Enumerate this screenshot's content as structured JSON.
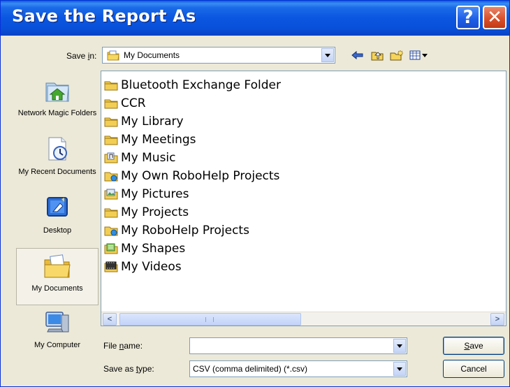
{
  "window": {
    "title": "Save the Report As",
    "help_glyph": "?",
    "close_glyph": "✕"
  },
  "save_in": {
    "label_pre": "Save ",
    "label_ul": "i",
    "label_post": "n:",
    "value": "My Documents",
    "icon": "my-documents-icon"
  },
  "toolbar": {
    "icons": [
      "back-arrow-icon",
      "up-folder-icon",
      "new-folder-icon",
      "view-menu-icon"
    ]
  },
  "places": [
    {
      "label": "Network Magic Folders",
      "icon": "network-magic-folders-icon",
      "active": false
    },
    {
      "label": "My Recent Documents",
      "icon": "recent-documents-icon",
      "active": false
    },
    {
      "label": "Desktop",
      "icon": "desktop-icon",
      "active": false
    },
    {
      "label": "My Documents",
      "icon": "my-documents-icon",
      "active": true
    },
    {
      "label": "My Computer",
      "icon": "my-computer-icon",
      "active": false
    }
  ],
  "files": [
    {
      "name": "Bluetooth Exchange Folder",
      "icon": "folder-icon"
    },
    {
      "name": "CCR",
      "icon": "folder-icon"
    },
    {
      "name": "My Library",
      "icon": "folder-icon"
    },
    {
      "name": "My Meetings",
      "icon": "folder-icon"
    },
    {
      "name": "My Music",
      "icon": "music-folder-icon"
    },
    {
      "name": "My Own RoboHelp Projects",
      "icon": "robohelp-folder-icon"
    },
    {
      "name": "My Pictures",
      "icon": "pictures-folder-icon"
    },
    {
      "name": "My Projects",
      "icon": "folder-icon"
    },
    {
      "name": "My RoboHelp Projects",
      "icon": "robohelp-folder-icon"
    },
    {
      "name": "My Shapes",
      "icon": "shapes-folder-icon"
    },
    {
      "name": "My Videos",
      "icon": "videos-folder-icon"
    }
  ],
  "file_name": {
    "label_pre": "File ",
    "label_ul": "n",
    "label_post": "ame:",
    "value": ""
  },
  "save_as_type": {
    "label_pre": "Save as ",
    "label_ul": "t",
    "label_post": "ype:",
    "value": "CSV (comma delimited) (*.csv)"
  },
  "buttons": {
    "save_ul": "S",
    "save_rest": "ave",
    "cancel": "Cancel"
  }
}
